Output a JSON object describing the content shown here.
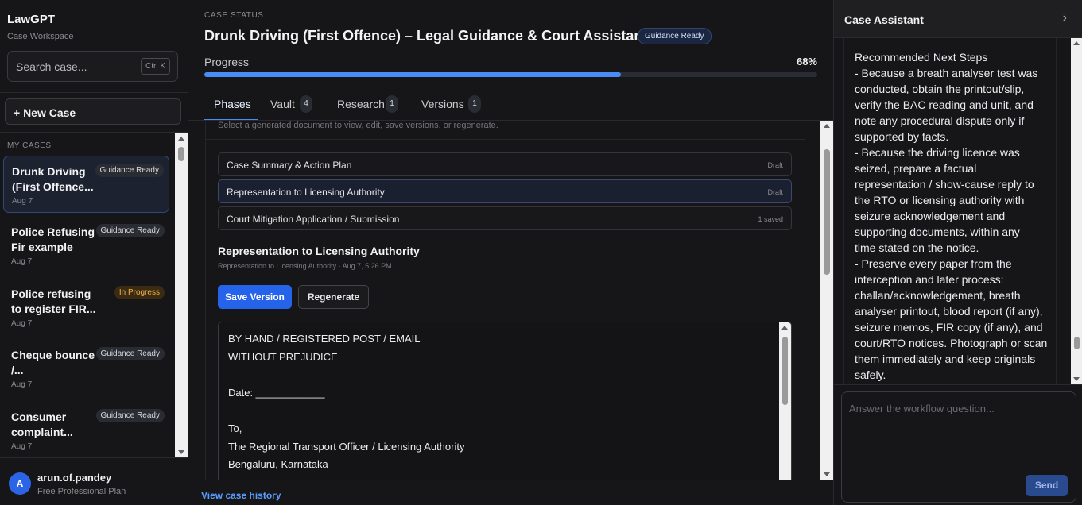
{
  "sidebar": {
    "brand": "LawGPT",
    "subtitle": "Case Workspace",
    "search_placeholder": "Search case...",
    "search_shortcut": "Ctrl K",
    "new_case": "+ New Case",
    "section_label": "MY CASES",
    "cases": [
      {
        "title": "Drunk Driving (First Offence...",
        "date": "Aug 7",
        "status": "Guidance Ready",
        "active": true
      },
      {
        "title": "Police Refusing Fir example",
        "date": "Aug 7",
        "status": "Guidance Ready",
        "active": false
      },
      {
        "title": "Police refusing to register FIR...",
        "date": "Aug 7",
        "status": "In Progress",
        "active": false
      },
      {
        "title": "Cheque bounce /...",
        "date": "Aug 7",
        "status": "Guidance Ready",
        "active": false
      },
      {
        "title": "Consumer complaint...",
        "date": "Aug 7",
        "status": "Guidance Ready",
        "active": false
      }
    ],
    "user": {
      "initial": "A",
      "name": "arun.of.pandey",
      "plan": "Free Professional Plan"
    }
  },
  "main": {
    "status_label": "CASE STATUS",
    "title": "Drunk Driving (First Offence) – Legal Guidance & Court Assistance",
    "title_badge": "Guidance Ready",
    "progress_label": "Progress",
    "progress_value": 68,
    "progress_text": "68%",
    "tabs": [
      {
        "label": "Phases",
        "count": null,
        "active": true
      },
      {
        "label": "Vault",
        "count": "4",
        "active": false
      },
      {
        "label": "Research",
        "count": "1",
        "active": false
      },
      {
        "label": "Versions",
        "count": "1",
        "active": false
      }
    ],
    "hint": "Select a generated document to view, edit, save versions, or regenerate.",
    "documents": [
      {
        "name": "Case Summary & Action Plan",
        "status": "Draft",
        "selected": false
      },
      {
        "name": "Representation to Licensing Authority",
        "status": "Draft",
        "selected": true
      },
      {
        "name": "Court Mitigation Application / Submission",
        "status": "1 saved",
        "selected": false
      }
    ],
    "selected_title": "Representation to Licensing Authority",
    "selected_meta": "Representation to Licensing Authority · Aug 7, 5:26 PM",
    "save_button": "Save Version",
    "regenerate_button": "Regenerate",
    "editor_lines": [
      "BY HAND / REGISTERED POST / EMAIL",
      "WITHOUT PREJUDICE",
      "",
      "Date: ____________",
      "",
      "To,",
      "The Regional Transport Officer / Licensing Authority",
      "Bengaluru, Karnataka"
    ],
    "history_link": "View case history"
  },
  "assistant": {
    "title": "Case Assistant",
    "lines": [
      "Recommended Next Steps",
      "- Because a breath analyser test was",
      "conducted, obtain the printout/slip,",
      "verify the BAC reading and unit, and",
      "note any procedural dispute only if",
      "supported by facts.",
      "- Because the driving licence was",
      "seized, prepare a factual",
      "representation / show-cause reply to",
      "the RTO or licensing authority with",
      "seizure acknowledgement and",
      "supporting documents, within any",
      "time stated on the notice.",
      "- Preserve every paper from the",
      "interception and later process:",
      "challan/acknowledgement, breath",
      "analyser printout, blood report (if any),",
      "seizure memos, FIR copy (if any), and",
      "court/RTO notices. Photograph or scan",
      "them immediately and keep originals",
      "safely."
    ],
    "input_placeholder": "Answer the workflow question...",
    "send_button": "Send"
  }
}
